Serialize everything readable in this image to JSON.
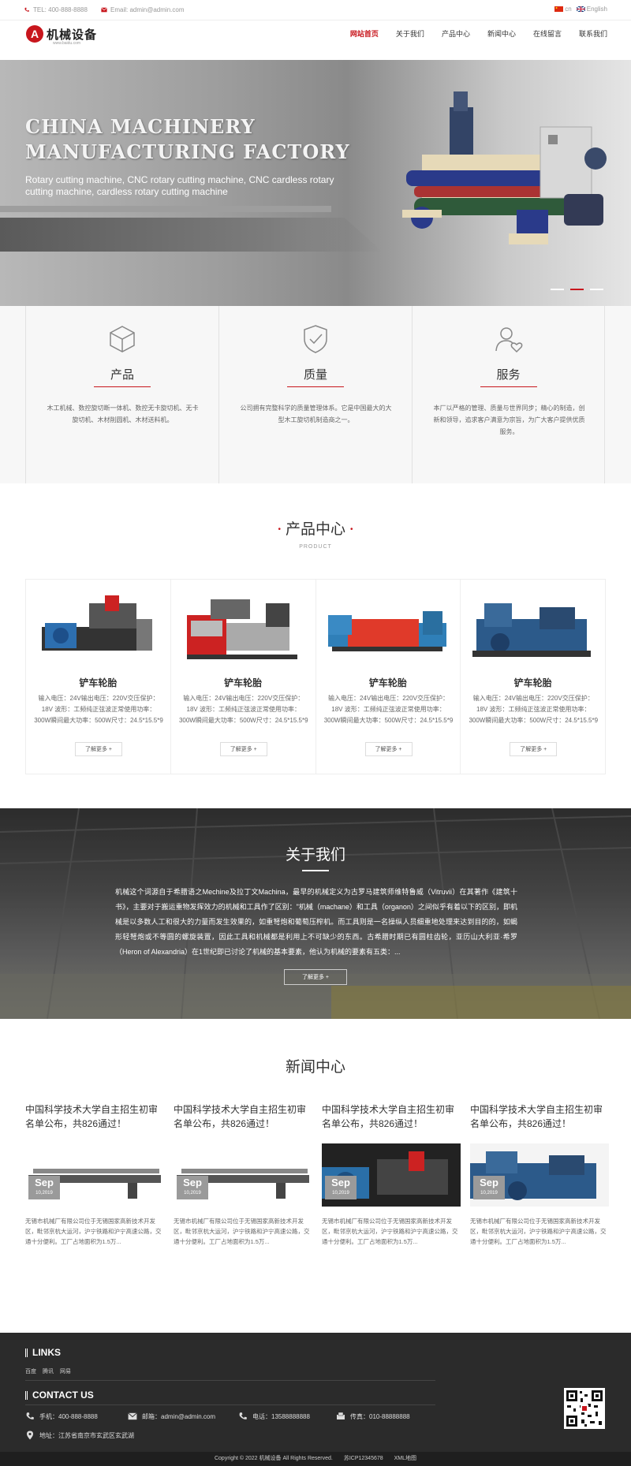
{
  "topbar": {
    "tel": "TEL: 400-888-8888",
    "email": "Email: admin@admin.com",
    "lang_cn": "cn",
    "lang_en": "English"
  },
  "header": {
    "logo_mark": "A",
    "logo_name": "机械设备",
    "logo_sub": "www.baidu.com",
    "nav": [
      "网站首页",
      "关于我们",
      "产品中心",
      "新闻中心",
      "在线留言",
      "联系我们"
    ]
  },
  "hero": {
    "title_line1": "CHINA MACHINERY",
    "title_line2": "MANUFACTURING FACTORY",
    "subtitle_line1": "Rotary cutting machine, CNC rotary cutting machine, CNC cardless rotary",
    "subtitle_line2": "cutting machine, cardless rotary cutting machine",
    "slide_count": 3,
    "active_slide": 2
  },
  "features": [
    {
      "icon": "cube-icon",
      "title": "产品",
      "desc": "木工机械、数控旋切断一体机、数控无卡旋切机、无卡旋切机、木材削圆机、木材送料机。"
    },
    {
      "icon": "shield-check-icon",
      "title": "质量",
      "desc": "公司拥有完整科学的质量管理体系。它是中国最大的大型木工旋切机制造商之一。"
    },
    {
      "icon": "user-heart-icon",
      "title": "服务",
      "desc": "本厂以严格的管理、质量与世界同步；精心的制造，创新和领导，追求客户满意为宗旨，为广大客户提供优质服务。"
    }
  ],
  "products_section": {
    "title": "产品中心",
    "subtitle": "PRODUCT",
    "items": [
      {
        "name": "铲车轮胎",
        "desc": "输入电压：24V输出电压：220V交压保护：18V 波形：工频纯正弦波正常使用功率：300W瞬间最大功率：500W尺寸：24.5*15.5*9重量：",
        "button": "了解更多 +"
      },
      {
        "name": "铲车轮胎",
        "desc": "输入电压：24V输出电压：220V交压保护：18V 波形：工频纯正弦波正常使用功率：300W瞬间最大功率：500W尺寸：24.5*15.5*9重量：",
        "button": "了解更多 +"
      },
      {
        "name": "铲车轮胎",
        "desc": "输入电压：24V输出电压：220V交压保护：18V 波形：工频纯正弦波正常使用功率：300W瞬间最大功率：500W尺寸：24.5*15.5*9重量：",
        "button": "了解更多 +"
      },
      {
        "name": "铲车轮胎",
        "desc": "输入电压：24V输出电压：220V交压保护：18V 波形：工频纯正弦波正常使用功率：300W瞬间最大功率：500W尺寸：24.5*15.5*9重量：",
        "button": "了解更多 +"
      }
    ]
  },
  "about": {
    "title": "关于我们",
    "text": "机械这个词源自于希腊语之Mechine及拉丁文Machina，最早的机械定义为古罗马建筑师维特鲁威（Vitruvii）在其著作《建筑十书》，主要对于搬运重物发挥效力的机械和工具作了区别：\"机械（machane）和工具（organon）之间似乎有着以下的区别，即机械是以多数人工和很大的力量而发生效果的，如重弩炮和葡萄压榨机。而工具则是一名操纵人员细重地处理来达到目的的，如蝎形轻弩炮或不等圆的螺旋装置，因此工具和机械都是利用上不可缺少的东西。古希腊时期已有圆柱齿轮，亚历山大利亚·希罗（Heron of Alexandria）在1世纪即已讨论了机械的基本要素，他认为机械的要素有五类：...",
    "button": "了解更多 +"
  },
  "news_section": {
    "title": "新闻中心",
    "items": [
      {
        "title": "中国科学技术大学自主招生初审名单公布，共826通过！",
        "month": "Sep",
        "year": "10,2019",
        "desc": "无锡市机械厂有限公司位于无锡国家高新技术开发区，毗邻京杭大运河，沪宁铁路和沪宁高速公路，交通十分便利。工厂占地面积为1.5万..."
      },
      {
        "title": "中国科学技术大学自主招生初审名单公布，共826通过！",
        "month": "Sep",
        "year": "10,2019",
        "desc": "无锡市机械厂有限公司位于无锡国家高新技术开发区，毗邻京杭大运河，沪宁铁路和沪宁高速公路，交通十分便利。工厂占地面积为1.5万..."
      },
      {
        "title": "中国科学技术大学自主招生初审名单公布，共826通过！",
        "month": "Sep",
        "year": "10,2019",
        "desc": "无锡市机械厂有限公司位于无锡国家高新技术开发区，毗邻京杭大运河，沪宁铁路和沪宁高速公路，交通十分便利。工厂占地面积为1.5万..."
      },
      {
        "title": "中国科学技术大学自主招生初审名单公布，共826通过！",
        "month": "Sep",
        "year": "10,2019",
        "desc": "无锡市机械厂有限公司位于无锡国家高新技术开发区，毗邻京杭大运河，沪宁铁路和沪宁高速公路，交通十分便利。工厂占地面积为1.5万..."
      }
    ]
  },
  "footer": {
    "links_title": "LINKS",
    "links": [
      "百度",
      "腾讯",
      "网易"
    ],
    "contact_title": "CONTACT US",
    "phone": "手机：400-888-8888",
    "email": "邮箱：admin@admin.com",
    "tel": "电话：13588888888",
    "fax": "传真：010-88888888",
    "address": "地址：江苏省南京市玄武区玄武湖",
    "copyright": "Copyright © 2022 机械设备 All Rights Reserved.",
    "icp": "苏ICP12345678",
    "xml": "XML地图"
  },
  "colors": {
    "accent": "#c8161d",
    "footer_bg": "#2b2b2b"
  }
}
